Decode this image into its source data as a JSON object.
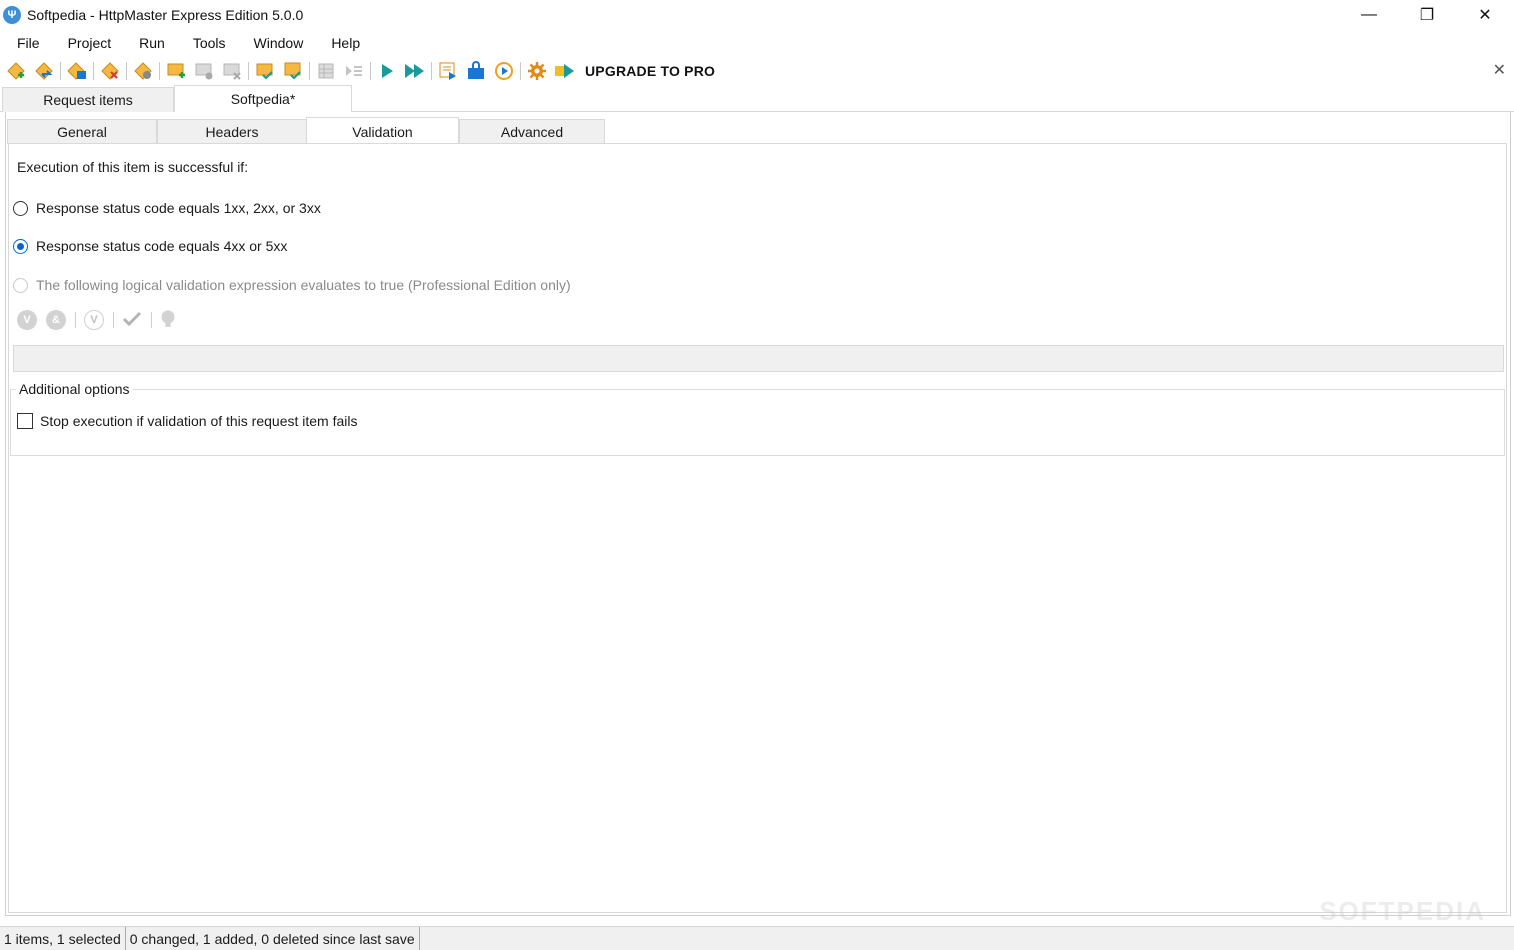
{
  "window": {
    "title": "Softpedia - HttpMaster Express Edition 5.0.0",
    "app_icon_glyph": "Ψ",
    "controls": {
      "minimize": "—",
      "maximize": "❐",
      "close": "✕"
    }
  },
  "menu": {
    "items": [
      "File",
      "Project",
      "Run",
      "Tools",
      "Window",
      "Help"
    ]
  },
  "toolbar": {
    "upgrade_label": "UPGRADE TO PRO",
    "close_glyph": "✕",
    "accent_colors": {
      "orange": "#f0a020",
      "teal": "#1a9a9a",
      "blue": "#1577d6"
    }
  },
  "doc_tabs": [
    "Request items",
    "Softpedia*"
  ],
  "sub_tabs": [
    "General",
    "Headers",
    "Validation",
    "Advanced"
  ],
  "validation": {
    "intro": "Execution of this item is successful if:",
    "options": [
      {
        "label": "Response status code equals 1xx, 2xx, or 3xx",
        "selected": false,
        "enabled": true
      },
      {
        "label": "Response status code equals 4xx or 5xx",
        "selected": true,
        "enabled": true
      },
      {
        "label": "The following logical validation expression evaluates to true (Professional Edition only)",
        "selected": false,
        "enabled": false
      }
    ],
    "expression_icons": [
      "V",
      "&",
      "V"
    ],
    "expression_value": ""
  },
  "additional_options": {
    "title": "Additional options",
    "stop_on_fail": {
      "label": "Stop execution if validation of this request item fails",
      "checked": false
    }
  },
  "status": {
    "items": "1 items, 1 selected",
    "changes": "0 changed, 1 added, 0 deleted since last save"
  },
  "watermark": "SOFTPEDIA"
}
